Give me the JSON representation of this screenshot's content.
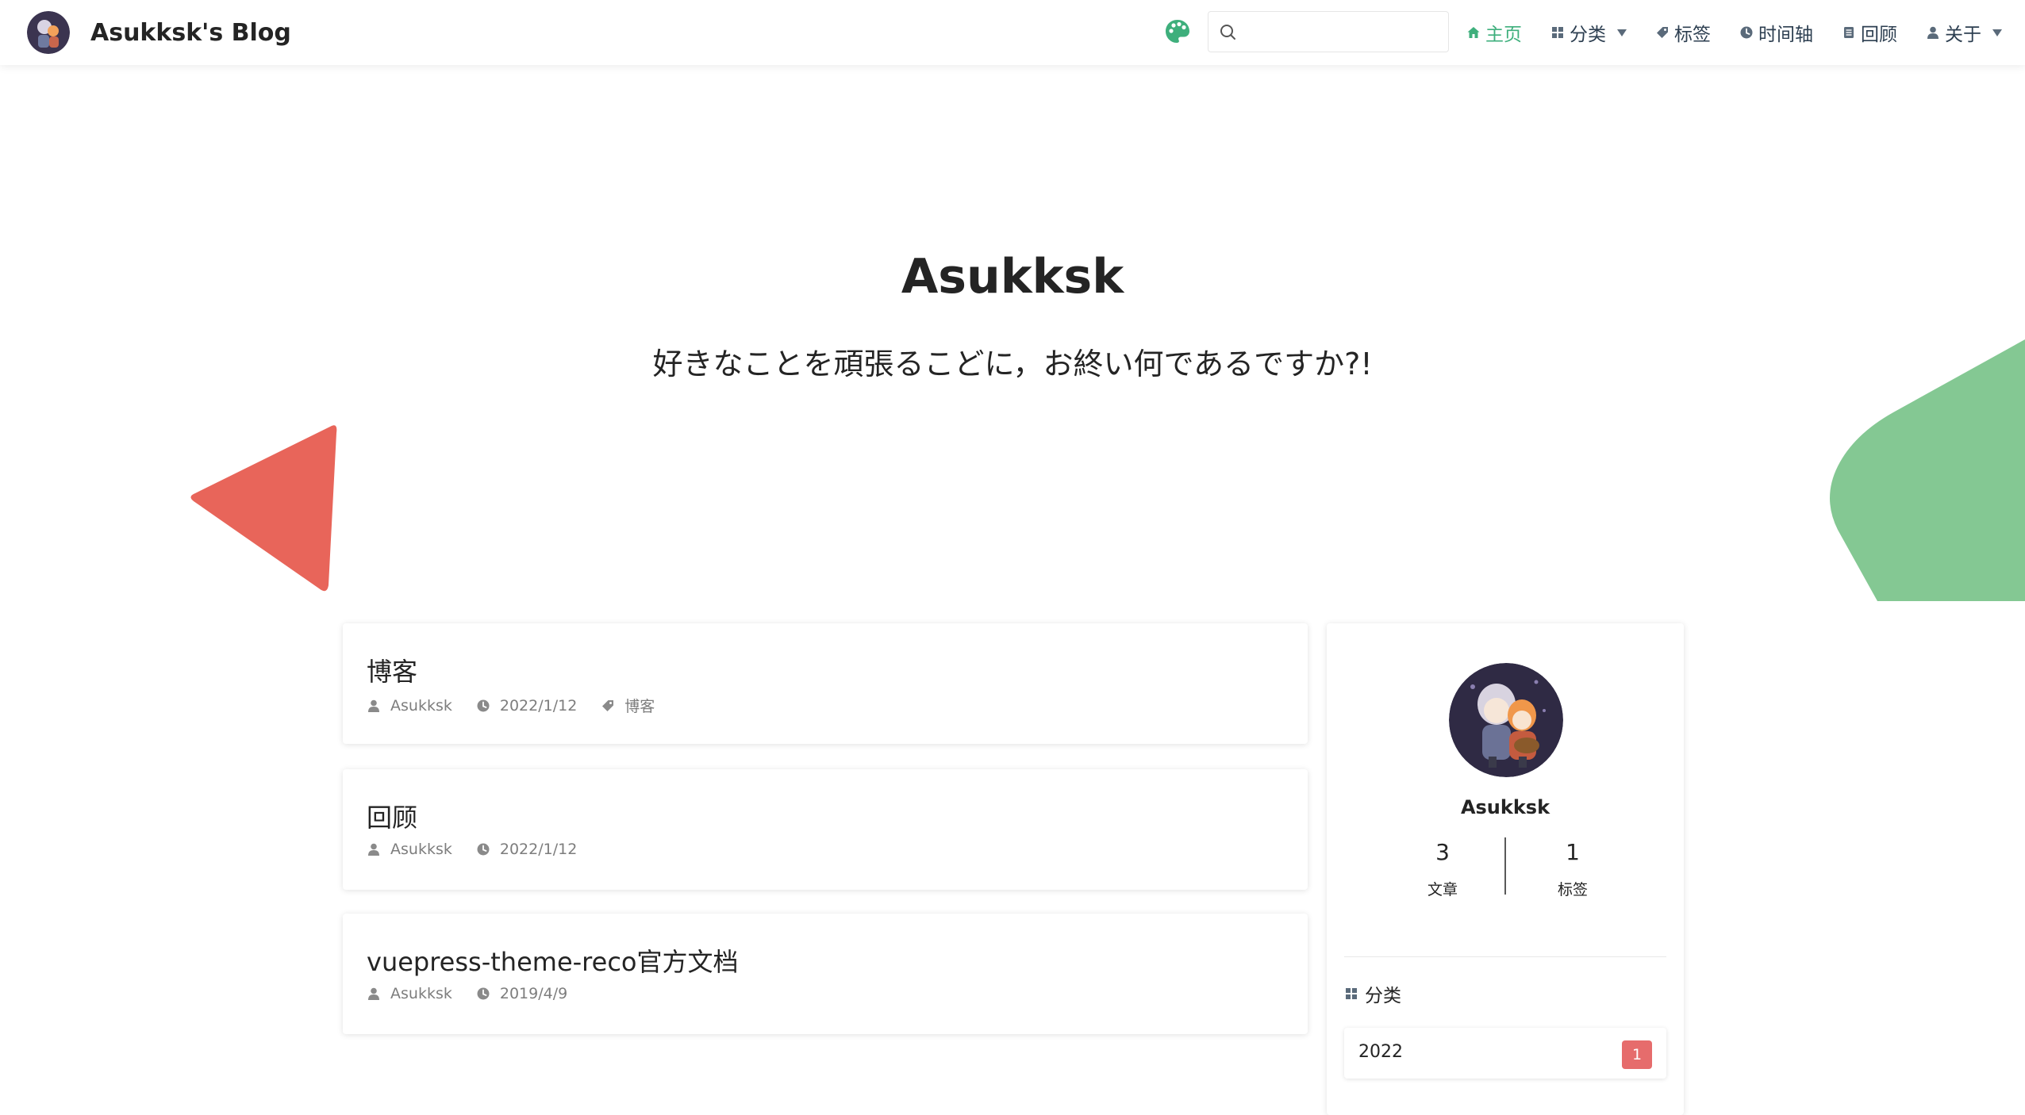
{
  "site": {
    "brand_title": "Asukksk's Blog"
  },
  "search": {
    "placeholder": ""
  },
  "nav": {
    "items": [
      {
        "label": "主页",
        "icon": "home-icon"
      },
      {
        "label": "分类",
        "icon": "category-icon"
      },
      {
        "label": "标签",
        "icon": "tag-icon"
      },
      {
        "label": "时间轴",
        "icon": "clock-icon"
      },
      {
        "label": "回顾",
        "icon": "document-icon"
      },
      {
        "label": "关于",
        "icon": "user-icon"
      }
    ]
  },
  "hero": {
    "title": "Asukksk",
    "subtitle": "好きなことを頑張るこどに，お終い何であるですか?!"
  },
  "posts": [
    {
      "title": "博客",
      "author": "Asukksk",
      "date": "2022/1/12",
      "tag": "博客"
    },
    {
      "title": "回顾",
      "author": "Asukksk",
      "date": "2022/1/12"
    },
    {
      "title": "vuepress-theme-reco官方文档",
      "author": "Asukksk",
      "date": "2019/4/9"
    }
  ],
  "profile": {
    "name": "Asukksk",
    "articles_count": "3",
    "articles_label": "文章",
    "tags_count": "1",
    "tags_label": "标签"
  },
  "categories": {
    "heading": "分类",
    "items": [
      {
        "name": "2022",
        "count": "1"
      }
    ]
  },
  "colors": {
    "accent": "#3eaf7c",
    "deco_red": "#e8655a",
    "deco_green": "#84c893",
    "badge": "#e66c6c"
  }
}
